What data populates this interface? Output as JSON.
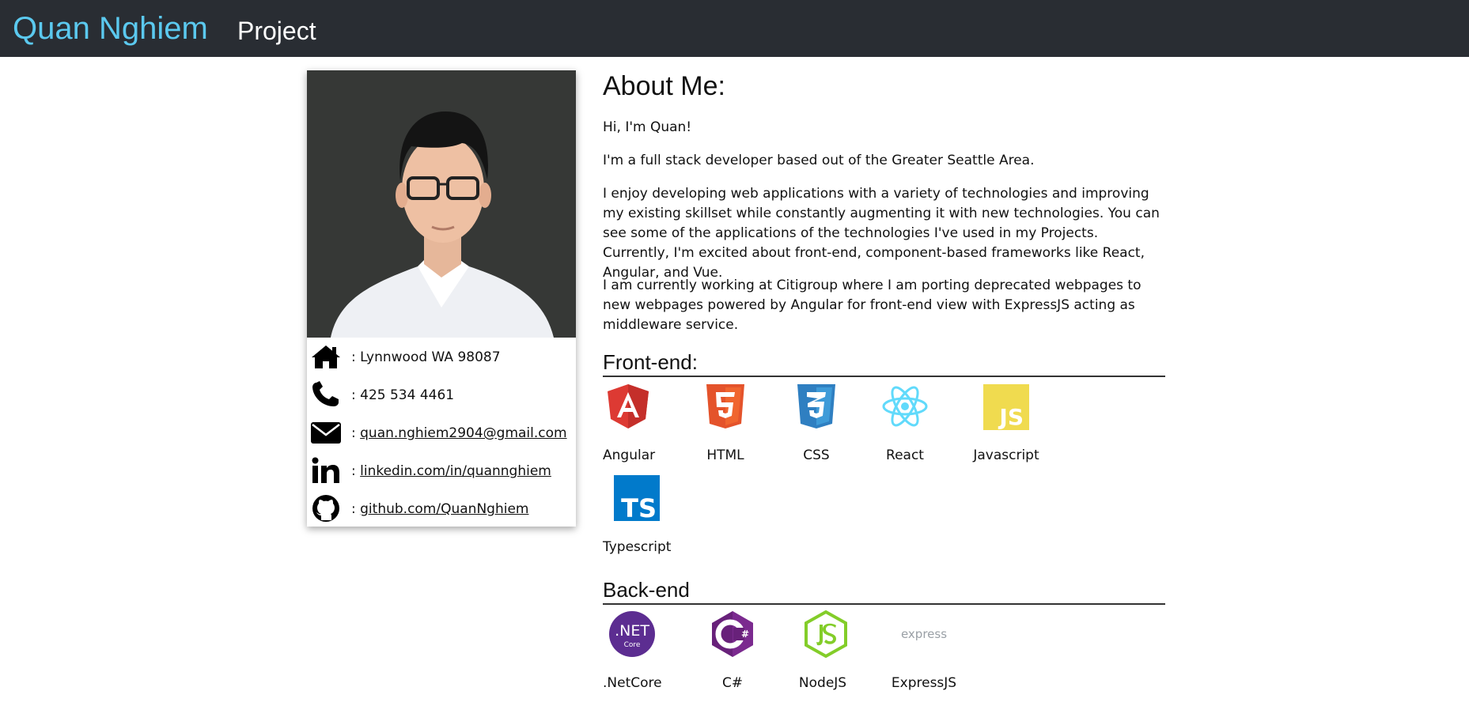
{
  "navbar": {
    "brand": "Quan Nghiem",
    "project_link": "Project"
  },
  "contact": {
    "address": ": Lynnwood WA 98087",
    "phone": ": 425 534 4461",
    "email_prefix": ": ",
    "email": "quan.nghiem2904@gmail.com",
    "linkedin_prefix": ": ",
    "linkedin": "linkedin.com/in/quannghiem",
    "github_prefix": ": ",
    "github": "github.com/QuanNghiem"
  },
  "about": {
    "title": "About Me:",
    "p1": "Hi, I'm Quan!",
    "p2": "I'm a full stack developer based out of the Greater Seattle Area.",
    "p3": "I enjoy developing web applications with a variety of technologies and improving my existing skillset while constantly augmenting it with new technologies. You can see some of the applications of the technologies I've used in my Projects. Currently, I'm excited about front-end, component-based frameworks like React, Angular, and Vue.",
    "p4": "I am currently working at Citigroup where I am porting deprecated webpages to new webpages powered by Angular for front-end view with ExpressJS acting as middleware service."
  },
  "frontend": {
    "title": "Front-end:",
    "items": [
      {
        "label": "Angular",
        "icon": "angular-icon"
      },
      {
        "label": "HTML",
        "icon": "html5-icon"
      },
      {
        "label": "CSS",
        "icon": "css3-icon"
      },
      {
        "label": "React",
        "icon": "react-icon"
      },
      {
        "label": "Javascript",
        "icon": "javascript-icon"
      },
      {
        "label": "Typescript",
        "icon": "typescript-icon"
      }
    ]
  },
  "backend": {
    "title": "Back-end",
    "items": [
      {
        "label": ".NetCore",
        "icon": "dotnet-core-icon",
        "logo_text": ".NET",
        "logo_subtext": "Core"
      },
      {
        "label": "C#",
        "icon": "csharp-icon"
      },
      {
        "label": "NodeJS",
        "icon": "nodejs-icon"
      },
      {
        "label": "ExpressJS",
        "icon": "express-icon",
        "logo_text": "express"
      }
    ]
  },
  "logos": {
    "js_text": "JS",
    "ts_text": "TS"
  },
  "colors": {
    "navbar_bg": "#292d33",
    "brand": "#5bc9ef",
    "angular": "#dd3a33",
    "html": "#e4532b",
    "css": "#2f7fc1",
    "react": "#61dafb",
    "javascript": "#f0db4f",
    "typescript": "#017acb",
    "dotnet": "#5c2d91",
    "csharp": "#68217a",
    "nodejs": "#83cd29"
  }
}
